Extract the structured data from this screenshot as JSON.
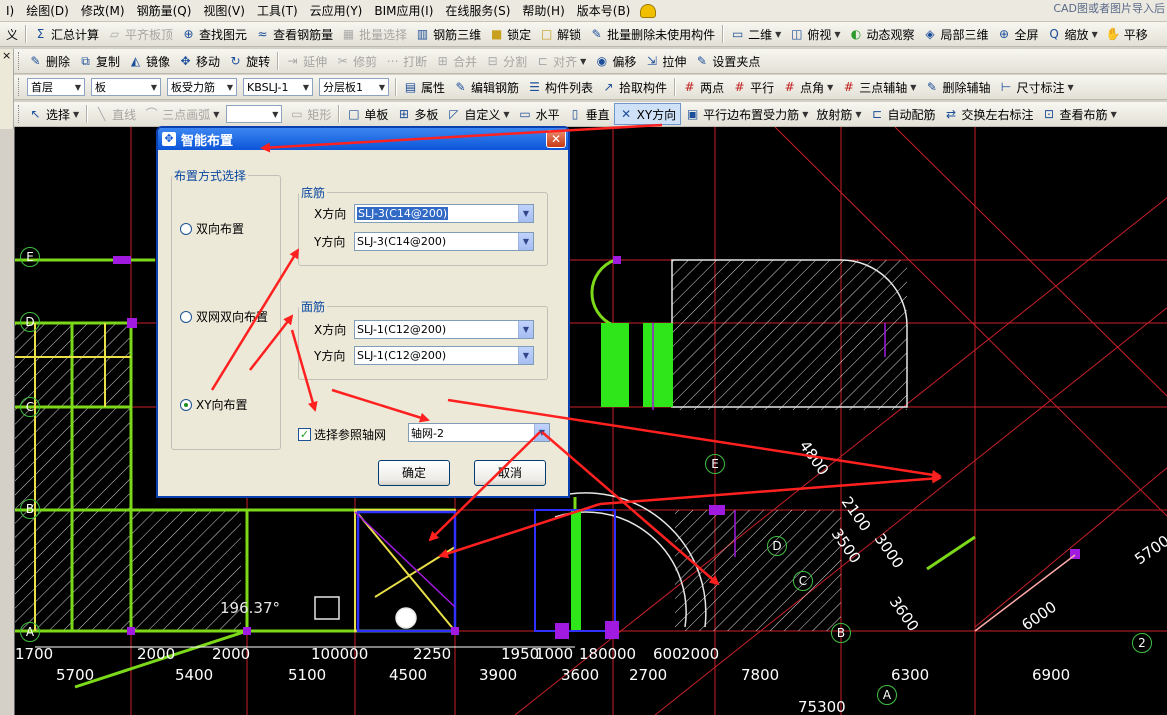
{
  "menubar": {
    "items": [
      "I)",
      "绘图(D)",
      "修改(M)",
      "钢筋量(Q)",
      "视图(V)",
      "工具(T)",
      "云应用(Y)",
      "BIM应用(I)",
      "在线服务(S)",
      "帮助(H)",
      "版本号(B)"
    ],
    "hint": "CAD图或者图片导入后"
  },
  "toolbar1": {
    "items": [
      "义",
      "汇总计算",
      "平齐板顶",
      "查找图元",
      "查看钢筋量",
      "批量选择",
      "钢筋三维",
      "锁定",
      "解锁",
      "批量删除未使用构件",
      "二维",
      "俯视",
      "动态观察",
      "局部三维",
      "全屏",
      "缩放",
      "平移"
    ]
  },
  "toolbar2": {
    "items": [
      "删除",
      "复制",
      "镜像",
      "移动",
      "旋转",
      "延伸",
      "修剪",
      "打断",
      "合并",
      "分割",
      "对齐",
      "偏移",
      "拉伸",
      "设置夹点"
    ]
  },
  "toolbar3": {
    "floor": "首层",
    "type": "板",
    "category": "板受力筋",
    "code": "KBSLJ-1",
    "layer": "分层板1",
    "items": [
      "属性",
      "编辑钢筋",
      "构件列表",
      "拾取构件",
      "两点",
      "平行",
      "点角",
      "三点辅轴",
      "删除辅轴",
      "尺寸标注"
    ]
  },
  "toolbar4": {
    "items": [
      "选择",
      "直线",
      "三点画弧",
      "矩形",
      "单板",
      "多板",
      "自定义",
      "水平",
      "垂直",
      "XY方向",
      "平行边布置受力筋",
      "放射筋",
      "自动配筋",
      "交换左右标注",
      "查看布筋"
    ]
  },
  "left_strip": {
    "close": "×"
  },
  "dialog": {
    "title": "智能布置",
    "group_method": "布置方式选择",
    "radio_options": [
      "双向布置",
      "双网双向布置",
      "XY向布置"
    ],
    "selected_index": 2,
    "group_bottom": "底筋",
    "group_top": "面筋",
    "x_label": "X方向",
    "y_label": "Y方向",
    "bottom_x": "SLJ-3(C14@200)",
    "bottom_y": "SLJ-3(C14@200)",
    "top_x": "SLJ-1(C12@200)",
    "top_y": "SLJ-1(C12@200)",
    "checkbox_label": "选择参照轴网",
    "checkbox_checked": true,
    "grid_value": "轴网-2",
    "ok": "确定",
    "cancel": "取消"
  },
  "drawing": {
    "angle": "196.37°",
    "axis_labels": [
      "E",
      "D",
      "C",
      "B",
      "A",
      "E",
      "D",
      "C",
      "B",
      "A",
      "2"
    ],
    "dims_row1": [
      "1700",
      "2000",
      "2000",
      "100000",
      "2250",
      "1950",
      "1000",
      "1800",
      "00",
      "600",
      "2000"
    ],
    "dims_row2": [
      "5700",
      "5400",
      "5100",
      "4500",
      "3900",
      "3600",
      "2700",
      "7800",
      "6300",
      "6900"
    ],
    "dims_total": "75300",
    "dims_diag": [
      "4800",
      "2100",
      "3000",
      "3500",
      "3600",
      "6000",
      "5700"
    ]
  },
  "colors": {
    "arrow": "#ff2020",
    "canvas": "#000000",
    "grid_red": "#c8202a",
    "beam_green": "#7cd91a",
    "wall_yellow": "#e9e047",
    "node_magenta": "#a01ae0"
  }
}
